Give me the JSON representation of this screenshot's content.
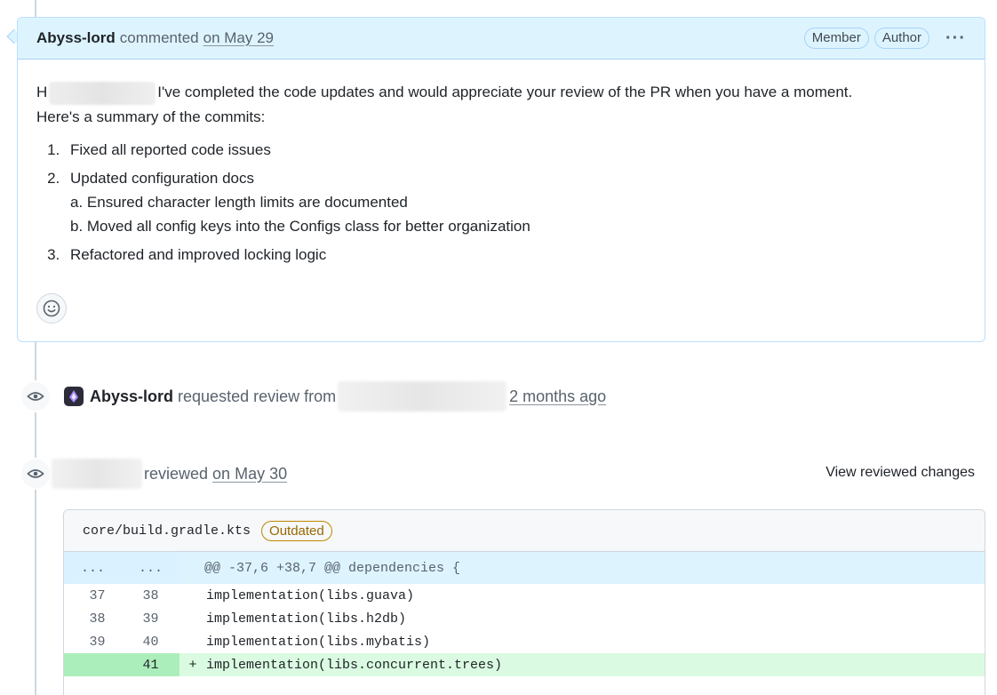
{
  "comment": {
    "author": "Abyss-lord",
    "action": "commented",
    "date": "on May 29",
    "badges": [
      "Member",
      "Author"
    ],
    "menu_glyph": "···",
    "greeting_start": "H",
    "intro_rest": "I've completed the code updates and would appreciate your review of the PR when you have a moment.",
    "intro_line2": "Here's a summary of the commits:",
    "items": [
      {
        "text": "Fixed all reported code issues"
      },
      {
        "text": "Updated configuration docs",
        "subitems": [
          "a. Ensured character length limits are documented",
          "b. Moved all config keys into the Configs class for better organization"
        ]
      },
      {
        "text": "Refactored and improved locking logic"
      }
    ]
  },
  "review_request": {
    "author": "Abyss-lord",
    "action": "requested review from",
    "time": "2 months ago"
  },
  "review": {
    "action": "reviewed",
    "date": "on May 30",
    "view_changes": "View reviewed changes"
  },
  "diff": {
    "file": "core/build.gradle.kts",
    "status": "Outdated",
    "hunk": {
      "left": "...",
      "right": "...",
      "header": "@@ -37,6 +38,7 @@ dependencies {"
    },
    "lines": [
      {
        "old": "37",
        "new": "38",
        "sign": "",
        "code": "implementation(libs.guava)",
        "type": "ctx"
      },
      {
        "old": "38",
        "new": "39",
        "sign": "",
        "code": "implementation(libs.h2db)",
        "type": "ctx"
      },
      {
        "old": "39",
        "new": "40",
        "sign": "",
        "code": "implementation(libs.mybatis)",
        "type": "ctx"
      },
      {
        "old": "",
        "new": "41",
        "sign": "+",
        "code": "implementation(libs.concurrent.trees)",
        "type": "add"
      }
    ]
  },
  "colors": {
    "header_bg": "#ddf4ff",
    "add_bg": "#dafbe1",
    "add_num_bg": "#aceebb",
    "outdated": "#9a6700"
  },
  "icons": [
    "smiley-icon",
    "eye-icon",
    "avatar-icon",
    "kebab-icon"
  ]
}
